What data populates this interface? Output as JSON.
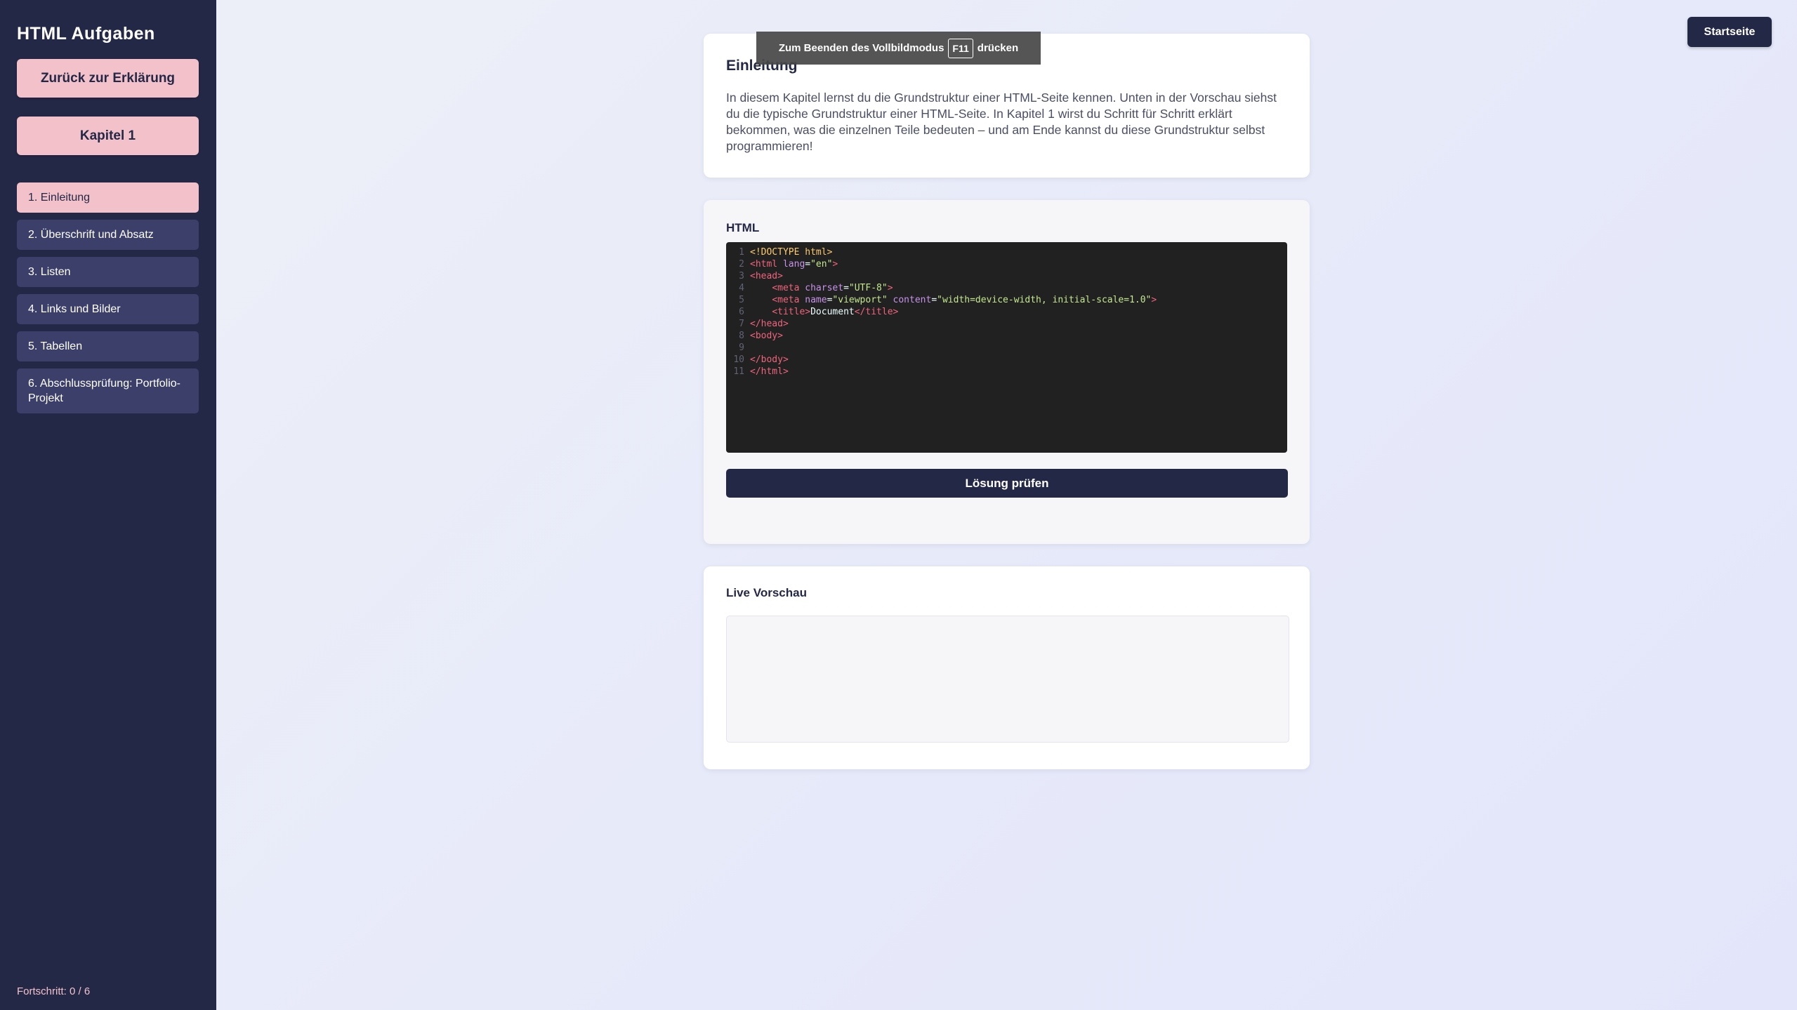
{
  "sidebar": {
    "title": "HTML Aufgaben",
    "back_button": "Zurück zur Erklärung",
    "chapter_button": "Kapitel 1",
    "items": [
      {
        "label": "1. Einleitung",
        "active": true
      },
      {
        "label": "2. Überschrift und Absatz",
        "active": false
      },
      {
        "label": "3. Listen",
        "active": false
      },
      {
        "label": "4. Links und Bilder",
        "active": false
      },
      {
        "label": "5. Tabellen",
        "active": false
      },
      {
        "label": "6. Abschlussprüfung: Portfolio-Projekt",
        "active": false
      }
    ],
    "progress": "Fortschritt: 0 / 6"
  },
  "header": {
    "home_button": "Startseite"
  },
  "fullscreen_toast": {
    "prefix": "Zum Beenden des Vollbildmodus",
    "key": "F11",
    "suffix": "drücken"
  },
  "intro": {
    "title": "Einleitung",
    "text": "In diesem Kapitel lernst du die Grundstruktur einer HTML-Seite kennen. Unten in der Vorschau siehst du die typische Grundstruktur einer HTML-Seite. In Kapitel 1 wirst du Schritt für Schritt erklärt bekommen, was die einzelnen Teile bedeuten – und am Ende kannst du diese Grundstruktur selbst programmieren!"
  },
  "editor": {
    "title": "HTML",
    "lines": [
      [
        {
          "t": "doc",
          "v": "<!DOCTYPE html>"
        }
      ],
      [
        {
          "t": "tag",
          "v": "<html "
        },
        {
          "t": "attr",
          "v": "lang"
        },
        {
          "t": "text",
          "v": "="
        },
        {
          "t": "str",
          "v": "\"en\""
        },
        {
          "t": "tag",
          "v": ">"
        }
      ],
      [
        {
          "t": "tag",
          "v": "<head>"
        }
      ],
      [
        {
          "t": "text",
          "v": "    "
        },
        {
          "t": "tag",
          "v": "<meta "
        },
        {
          "t": "attr",
          "v": "charset"
        },
        {
          "t": "text",
          "v": "="
        },
        {
          "t": "str",
          "v": "\"UTF-8\""
        },
        {
          "t": "tag",
          "v": ">"
        }
      ],
      [
        {
          "t": "text",
          "v": "    "
        },
        {
          "t": "tag",
          "v": "<meta "
        },
        {
          "t": "attr",
          "v": "name"
        },
        {
          "t": "text",
          "v": "="
        },
        {
          "t": "str",
          "v": "\"viewport\" "
        },
        {
          "t": "attr",
          "v": "content"
        },
        {
          "t": "text",
          "v": "="
        },
        {
          "t": "str",
          "v": "\"width=device-width, initial-scale=1.0\""
        },
        {
          "t": "tag",
          "v": ">"
        }
      ],
      [
        {
          "t": "text",
          "v": "    "
        },
        {
          "t": "tag",
          "v": "<title>"
        },
        {
          "t": "text",
          "v": "Document"
        },
        {
          "t": "tag",
          "v": "</title>"
        }
      ],
      [
        {
          "t": "tag",
          "v": "</head>"
        }
      ],
      [
        {
          "t": "tag",
          "v": "<body>"
        }
      ],
      [
        {
          "t": "text",
          "v": ""
        }
      ],
      [
        {
          "t": "tag",
          "v": "</body>"
        }
      ],
      [
        {
          "t": "tag",
          "v": "</html>"
        }
      ]
    ],
    "check_button": "Lösung prüfen"
  },
  "preview": {
    "title": "Live Vorschau"
  }
}
